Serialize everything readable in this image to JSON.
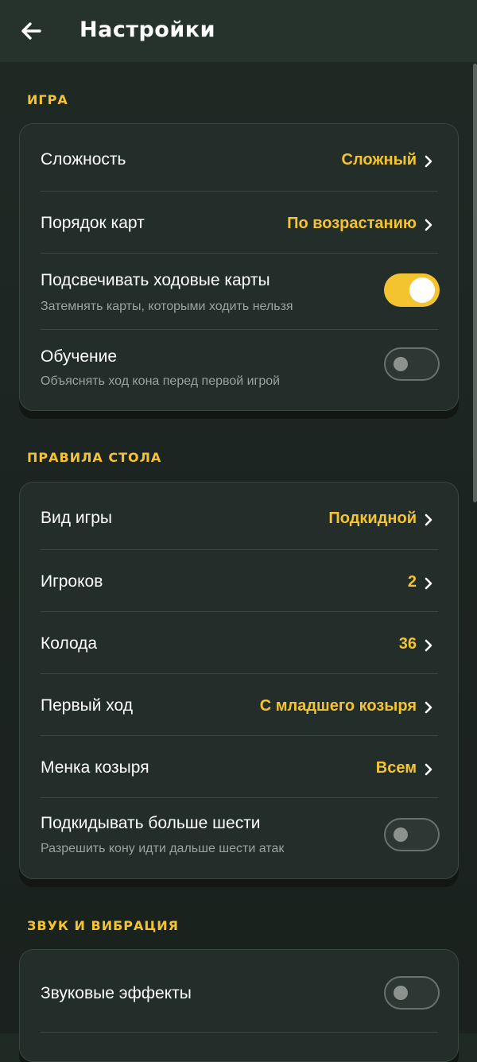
{
  "header": {
    "title": "Настройки",
    "back_icon": "arrow-left-icon"
  },
  "sections": [
    {
      "title": "ИГРА",
      "rows": [
        {
          "label": "Сложность",
          "value": "Сложный"
        },
        {
          "label": "Порядок карт",
          "value": "По возрастанию"
        },
        {
          "label": "Подсвечивать ходовые карты",
          "subtitle": "Затемнять карты, которыми ходить нельзя",
          "toggle": true
        },
        {
          "label": "Обучение",
          "subtitle": "Объяснять ход кона перед первой игрой",
          "toggle": false
        }
      ]
    },
    {
      "title": "ПРАВИЛА СТОЛА",
      "rows": [
        {
          "label": "Вид игры",
          "value": "Подкидной"
        },
        {
          "label": "Игроков",
          "value": "2"
        },
        {
          "label": "Колода",
          "value": "36"
        },
        {
          "label": "Первый ход",
          "value": "С младшего козыря"
        },
        {
          "label": "Менка козыря",
          "value": "Всем"
        },
        {
          "label": "Подкидывать больше шести",
          "subtitle": "Разрешить кону идти дальше шести атак",
          "toggle": false
        }
      ]
    },
    {
      "title": "ЗВУК И ВИБРАЦИЯ",
      "rows": [
        {
          "label": "Звуковые эффекты",
          "toggle": false
        }
      ]
    }
  ],
  "colors": {
    "accent": "#f4c430",
    "background": "#1d2622",
    "card": "#232d29",
    "appbar": "#26332d"
  }
}
